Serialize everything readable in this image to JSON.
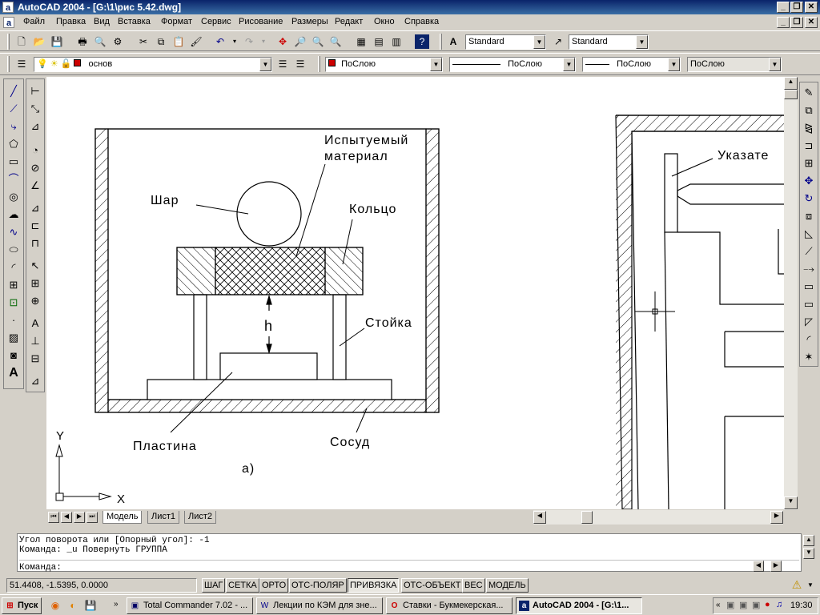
{
  "window": {
    "title": "AutoCAD 2004 - [G:\\1\\рис 5.42.dwg]",
    "app_icon_letter": "a"
  },
  "menu": [
    "Файл",
    "Правка",
    "Вид",
    "Вставка",
    "Формат",
    "Сервис",
    "Рисование",
    "Размеры",
    "Редакт",
    "Окно",
    "Справка"
  ],
  "styles": {
    "text_style": "Standard",
    "dim_style": "Standard"
  },
  "layers": {
    "layer_name": "основ",
    "color": "ПоСлою",
    "linetype": "ПоСлою",
    "lineweight": "ПоСлою",
    "plotstyle": "ПоСлою",
    "layer_color_hex": "#cc0000"
  },
  "drawing": {
    "labels": {
      "tested_material_1": "Испытуемый",
      "tested_material_2": "материал",
      "ball": "Шар",
      "ring": "Кольцо",
      "h": "h",
      "stand": "Стойка",
      "plate": "Пластина",
      "vessel": "Сосуд",
      "figure_a": "а)",
      "pointer": "Указате",
      "ucs_y": "Y",
      "ucs_x": "X"
    }
  },
  "layout_tabs": [
    "Модель",
    "Лист1",
    "Лист2"
  ],
  "command": {
    "lines": [
      "Угол поворота или [Опорный угол]: -1",
      "Команда: _u Повернуть ГРУППА"
    ],
    "prompt": "Команда:"
  },
  "status": {
    "coords": "51.4408, -1.5395, 0.0000",
    "buttons": [
      {
        "label": "ШАГ",
        "on": false
      },
      {
        "label": "СЕТКА",
        "on": false
      },
      {
        "label": "ОРТО",
        "on": false
      },
      {
        "label": "ОТС-ПОЛЯР",
        "on": false
      },
      {
        "label": "ПРИВЯЗКА",
        "on": true
      },
      {
        "label": "ОТС-ОБЪЕКТ",
        "on": false
      },
      {
        "label": "ВЕС",
        "on": false
      },
      {
        "label": "МОДЕЛЬ",
        "on": false
      }
    ]
  },
  "taskbar": {
    "start": "Пуск",
    "tasks": [
      "Total Commander 7.02 - ...",
      "Лекции по КЭМ для зне...",
      "Ставки - Букмекерская...",
      "AutoCAD 2004 - [G:\\1..."
    ],
    "clock": "19:30"
  }
}
